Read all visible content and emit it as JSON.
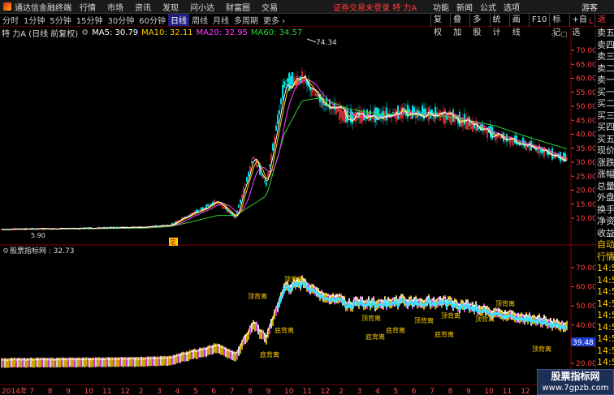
{
  "app": {
    "title": "通达信金融终端",
    "menu": [
      "行情",
      "市场",
      "资讯",
      "发现",
      "问小达",
      "财富圈",
      "交易"
    ],
    "notice": "证券交易未登录",
    "stock_name": "特 力A",
    "right_menu": [
      "功能",
      "新闻",
      "公式",
      "选项"
    ],
    "guest": "游客"
  },
  "period_tabs": [
    "分时",
    "1分钟",
    "5分钟",
    "15分钟",
    "30分钟",
    "60分钟",
    "日线",
    "周线",
    "月线",
    "多周期",
    "更多"
  ],
  "period_active": 6,
  "tools": [
    "复权",
    "叠加",
    "多股",
    "统计",
    "画线",
    "F10",
    "标记",
    "+自选",
    "返回"
  ],
  "info": {
    "title": "特 力A (日线 前复权)",
    "ma5": "MA5: 30.79",
    "ma10": "MA10: 32.11",
    "ma20": "MA20: 32.95",
    "ma60": "MA60: 34.57",
    "colors": {
      "ma5": "#ffffff",
      "ma10": "#ffd000",
      "ma20": "#ff40ff",
      "ma60": "#30d030"
    }
  },
  "main_chart": {
    "peak_label": "74.34",
    "low_label": "5.90",
    "ding_marker": "定",
    "yaxis": [
      "70.00",
      "65.00",
      "60.00",
      "55.00",
      "50.00",
      "45.00",
      "40.00",
      "35.00",
      "30.00",
      "25.00",
      "20.00",
      "15.00",
      "10.00"
    ]
  },
  "indicator": {
    "title": "股票指标网 : 32.73",
    "yaxis": [
      "70.00",
      "60.00",
      "50.00",
      "40.00",
      "30.00",
      "20.00"
    ],
    "current": "39.48",
    "labels": [
      "顶背离",
      "底背离"
    ]
  },
  "sidebar": {
    "badge": "L",
    "items": [
      "卖五",
      "卖四",
      "卖三",
      "卖二",
      "卖一",
      "买一",
      "买二",
      "买三",
      "买四",
      "买五",
      "现价",
      "涨跌",
      "涨幅",
      "总量",
      "外盘",
      "换手",
      "净资",
      "收益",
      "自动",
      "行情",
      "14:5",
      "14:5",
      "14:5",
      "14:5",
      "14:5",
      "14:5",
      "14:5",
      "14:5",
      "14:5",
      "14:5",
      "14:5"
    ]
  },
  "bottom_axis": [
    "2014年",
    "7",
    "8",
    "9",
    "10",
    "11",
    "12",
    "2",
    "3",
    "4",
    "5",
    "6",
    "7",
    "8",
    "9",
    "10",
    "11",
    "12",
    "2",
    "3",
    "4",
    "5",
    "6",
    "7",
    "8",
    "9",
    "10",
    "11",
    "12",
    "2",
    "3",
    "4"
  ],
  "watermark": {
    "line1": "股票指标网",
    "line2": "www.7gpzb.com"
  },
  "chart_data": {
    "type": "line",
    "title": "特 力A (日线 前复权)",
    "x": [
      "2014-07",
      "2014-10",
      "2015-01",
      "2015-03",
      "2015-05",
      "2015-06",
      "2015-08",
      "2015-10",
      "2015-11",
      "2015-12",
      "2016-01",
      "2016-03",
      "2016-05",
      "2016-07",
      "2016-09",
      "2016-11",
      "2017-01",
      "2017-03",
      "2017-04"
    ],
    "series": [
      {
        "name": "MA5",
        "values": [
          6.0,
          6.3,
          6.8,
          7.5,
          12,
          16,
          10,
          32,
          22,
          58,
          60,
          52,
          46,
          47,
          48,
          46,
          40,
          36,
          31
        ]
      },
      {
        "name": "MA60",
        "values": [
          6.0,
          6.2,
          6.5,
          7.0,
          9,
          11,
          11,
          15,
          18,
          40,
          52,
          53,
          49,
          47,
          47,
          46,
          43,
          39,
          34.6
        ]
      }
    ],
    "ylim": [
      5,
      75
    ]
  }
}
